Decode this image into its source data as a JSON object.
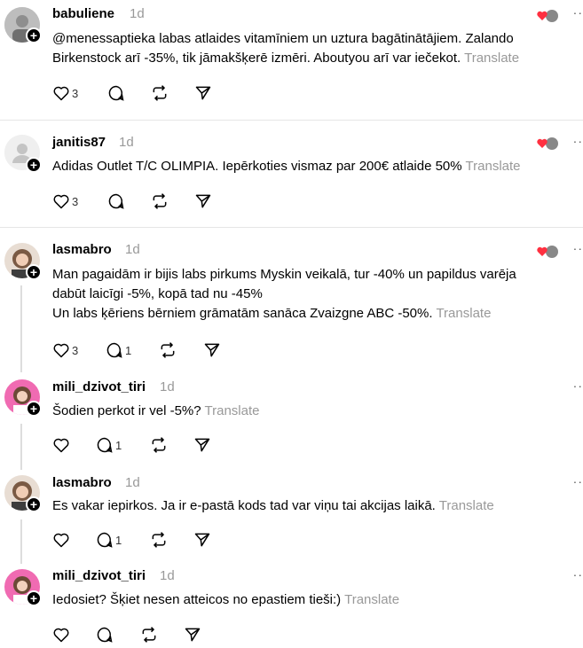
{
  "posts": [
    {
      "user": "babuliene",
      "time": "1d",
      "lines": [
        "@menessaptieka labas atlaides vitamīniem un uztura bagātinātājiem. Zalando",
        "Birkenstock arī -35%, tik jāmakšķerē izmēri. Aboutyou arī var iečekot."
      ],
      "translate": "Translate",
      "likes": "3",
      "replies": ""
    },
    {
      "user": "janitis87",
      "time": "1d",
      "lines": [
        "Adidas Outlet T/C OLIMPIA. Iepērkoties vismaz par 200€ atlaide 50%"
      ],
      "translate": "Translate",
      "likes": "3",
      "replies": ""
    },
    {
      "user": "lasmabro",
      "time": "1d",
      "lines": [
        "Man pagaidām ir bijis labs pirkums Myskin veikalā, tur -40% un papildus varēja",
        "dabūt laicīgi -5%, kopā tad nu -45%",
        "Un labs ķēriens bērniem grāmatām sanāca Zvaizgne ABC -50%."
      ],
      "translate": "Translate",
      "likes": "3",
      "replies": "1"
    },
    {
      "user": "mili_dzivot_tiri",
      "time": "1d",
      "lines": [
        "Šodien perkot ir vel -5%?"
      ],
      "translate": "Translate",
      "likes": "",
      "replies": "1"
    },
    {
      "user": "lasmabro",
      "time": "1d",
      "lines": [
        "Es vakar iepirkos. Ja ir e-pastā kods tad var viņu tai akcijas laikā."
      ],
      "translate": "Translate",
      "likes": "",
      "replies": "1"
    },
    {
      "user": "mili_dzivot_tiri",
      "time": "1d",
      "lines": [
        "Iedosiet? Šķiet nesen atteicos no epastiem tieši:)"
      ],
      "translate": "Translate",
      "likes": "",
      "replies": ""
    }
  ],
  "more_label": "··",
  "plus_label": "+",
  "colors": {
    "heart": "#ff3040",
    "muted": "#999999",
    "divider": "#e5e5e5"
  }
}
